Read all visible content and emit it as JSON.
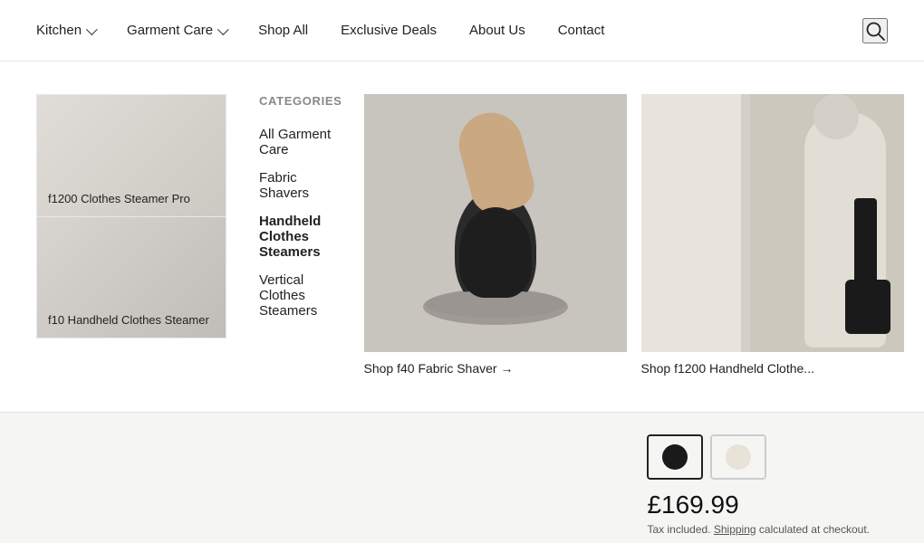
{
  "header": {
    "nav_items": [
      {
        "id": "kitchen",
        "label": "Kitchen",
        "has_chevron": true,
        "active": false
      },
      {
        "id": "garment-care",
        "label": "Garment Care",
        "has_chevron": true,
        "active": true
      },
      {
        "id": "shop-all",
        "label": "Shop All",
        "has_chevron": false,
        "active": false
      },
      {
        "id": "exclusive-deals",
        "label": "Exclusive Deals",
        "has_chevron": false,
        "active": false
      },
      {
        "id": "about-us",
        "label": "About Us",
        "has_chevron": false,
        "active": false
      },
      {
        "id": "contact",
        "label": "Contact",
        "has_chevron": false,
        "active": false
      }
    ]
  },
  "dropdown": {
    "categories_title": "Categories",
    "categories": [
      {
        "id": "all-garment-care",
        "label": "All Garment Care",
        "bold": false
      },
      {
        "id": "fabric-shavers",
        "label": "Fabric Shavers",
        "bold": false
      },
      {
        "id": "handheld-steamers",
        "label": "Handheld Clothes Steamers",
        "bold": true
      },
      {
        "id": "vertical-steamers",
        "label": "Vertical Clothes Steamers",
        "bold": false
      }
    ],
    "products": [
      {
        "id": "f1200-steamer-pro",
        "label": "f1200 Clothes Steamer Pro"
      },
      {
        "id": "f10-handheld",
        "label": "f10 Handheld Clothes Steamer"
      }
    ],
    "feature_cards": [
      {
        "id": "f40-fabric-shaver",
        "caption": "Shop f40 Fabric Shaver →"
      },
      {
        "id": "f1200-handheld",
        "caption": "Shop f1200 Handheld Clothe..."
      }
    ]
  },
  "product": {
    "price": "£169.99",
    "price_note": "Tax included.",
    "shipping_label": "Shipping",
    "shipping_suffix": " calculated at checkout.",
    "swatches": [
      {
        "id": "dark",
        "color": "#1a1a1a",
        "selected": true
      },
      {
        "id": "light",
        "color": "#e8e2d8",
        "selected": false
      }
    ]
  }
}
